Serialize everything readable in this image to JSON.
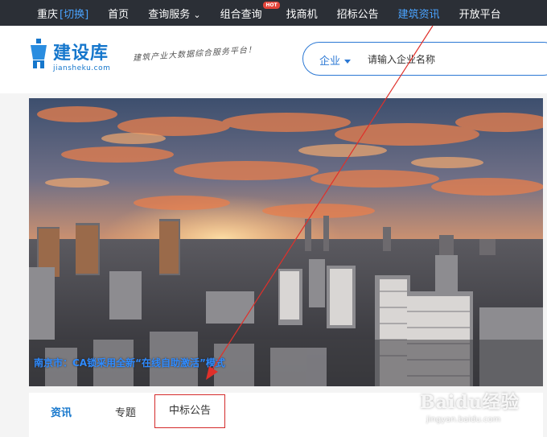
{
  "topnav": {
    "city": "重庆",
    "city_switch": "[切换]",
    "items": [
      "首页",
      "查询服务",
      "组合查询",
      "找商机",
      "招标公告",
      "建筑资讯",
      "开放平台"
    ],
    "hot_badge": "HOT",
    "query_service_caret": "⌄"
  },
  "header": {
    "logo_text": "建设库",
    "logo_sub": "jiansheku.com",
    "slogan": "建筑产业大数据综合服务平台！",
    "search": {
      "category": "企业",
      "placeholder": "请输入企业名称"
    }
  },
  "hero": {
    "caption": "南京市：CA锁采用全新“在线自助激活”模式"
  },
  "tabs": [
    "资讯",
    "专题",
    "中标公告"
  ],
  "watermark": {
    "brand": "Baidu经验",
    "url": "jingyan.baidu.com"
  },
  "colors": {
    "nav_bg": "#2b2f36",
    "accent": "#1677cc",
    "highlight_box": "#d42a2a",
    "arrow": "#e0302a"
  }
}
